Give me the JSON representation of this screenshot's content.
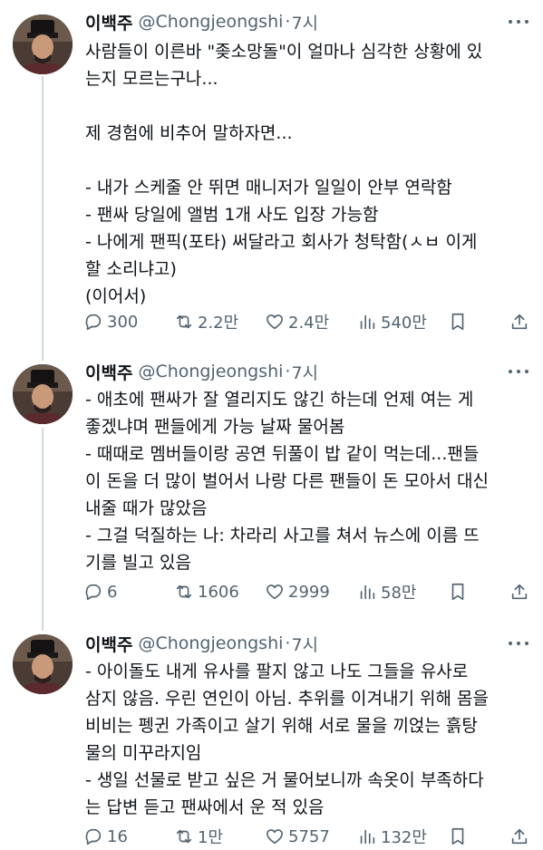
{
  "tweets": [
    {
      "name": "이백주",
      "handle": "@Chongjeongshi",
      "dot": "·",
      "time": "7시",
      "text": "사람들이 이른바 \"좆소망돌\"이 얼마나 심각한 상황에 있\n는지 모르는구나...\n\n제 경험에 비추어 말하자면...\n\n- 내가 스케줄 안 뛰면 매니저가 일일이 안부 연락함\n- 팬싸 당일에 앨범 1개 사도 입장 가능함\n- 나에게 팬픽(포타) 써달라고 회사가 청탁함(ㅅㅂ 이게\n할 소리냐고)\n(이어서)",
      "replies": "300",
      "retweets": "2.2만",
      "likes": "2.4만",
      "views": "540만"
    },
    {
      "name": "이백주",
      "handle": "@Chongjeongshi",
      "dot": "·",
      "time": "7시",
      "text": "- 애초에 팬싸가 잘 열리지도 않긴 하는데 언제 여는 게\n좋겠냐며 팬들에게 가능 날짜 물어봄\n- 때때로 멤버들이랑 공연 뒤풀이 밥 같이 먹는데...팬들\n이 돈을 더 많이 벌어서 나랑 다른 팬들이 돈 모아서 대신\n내줄 때가 많았음\n- 그걸 덕질하는 나: 차라리 사고를 쳐서 뉴스에 이름 뜨\n기를 빌고 있음",
      "replies": "6",
      "retweets": "1606",
      "likes": "2999",
      "views": "58만"
    },
    {
      "name": "이백주",
      "handle": "@Chongjeongshi",
      "dot": "·",
      "time": "7시",
      "text": "- 아이돌도 내게 유사를 팔지 않고 나도 그들을 유사로\n삼지 않음. 우린 연인이 아님. 추위를 이겨내기 위해 몸을\n비비는 펭귄 가족이고 살기 위해 서로 물을 끼얹는 흙탕\n물의 미꾸라지임\n- 생일 선물로 받고 싶은 거 물어보니까 속옷이 부족하다\n는 답변 듣고 팬싸에서 운 적 있음",
      "replies": "16",
      "retweets": "1만",
      "likes": "5757",
      "views": "132만"
    }
  ],
  "icons": {
    "reply": "reply-icon",
    "retweet": "retweet-icon",
    "like": "heart-icon",
    "views": "views-icon",
    "bookmark": "bookmark-icon",
    "share": "share-icon",
    "more": "more-icon"
  },
  "colors": {
    "text": "#0f1419",
    "secondary": "#536471",
    "thread_line": "#cfd9de",
    "divider": "#eff3f4"
  }
}
